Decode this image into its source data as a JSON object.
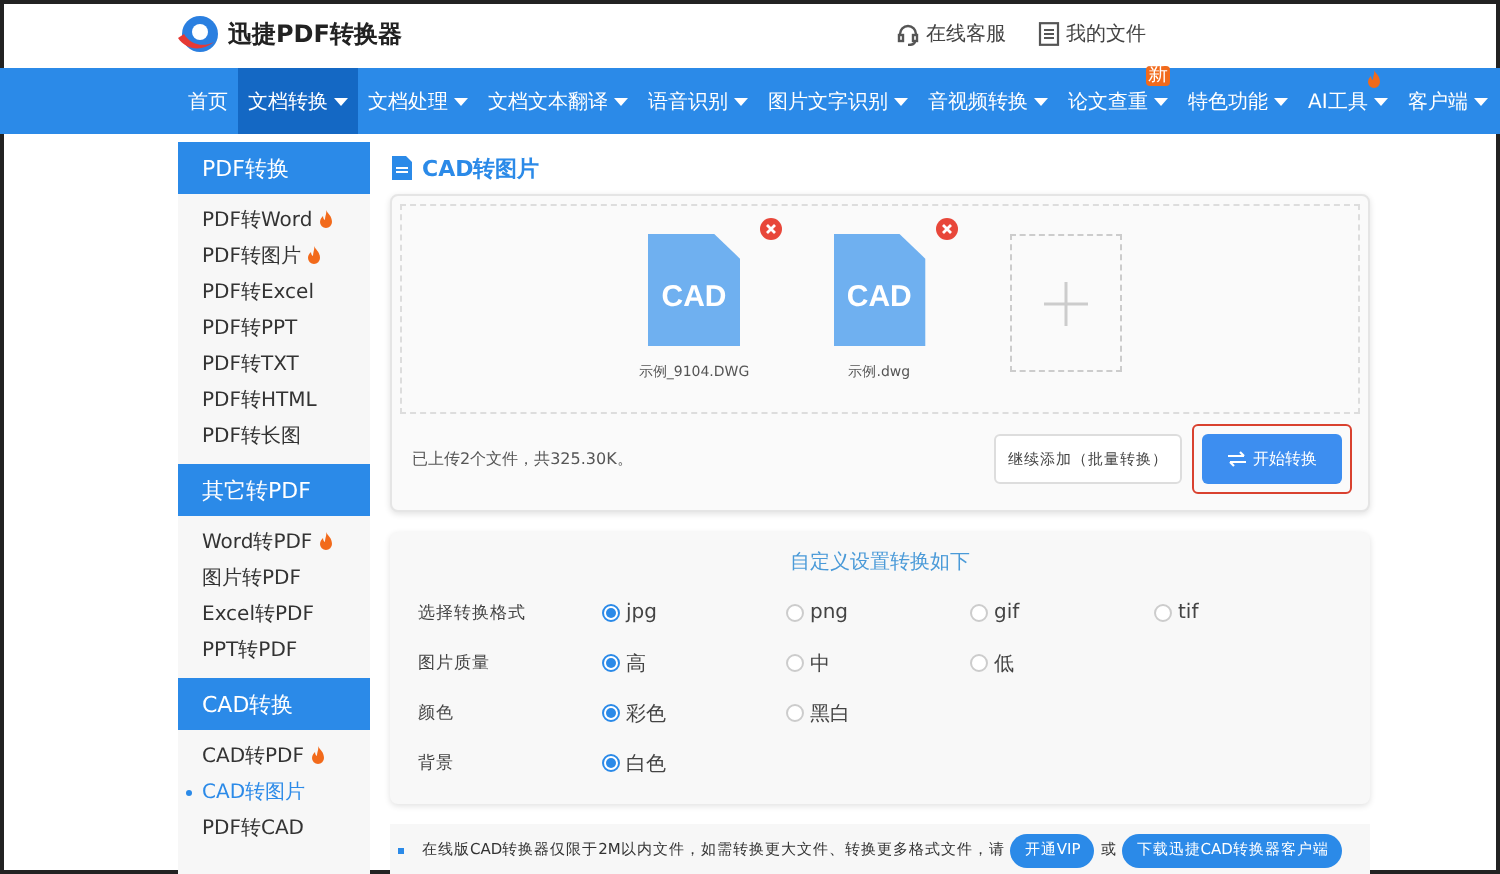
{
  "header": {
    "logo_text": "迅捷PDF转换器",
    "links": [
      {
        "kind": "headset",
        "label": "在线客服"
      },
      {
        "kind": "file",
        "label": "我的文件"
      }
    ]
  },
  "nav": [
    {
      "label": "首页",
      "selected": false,
      "caret": false
    },
    {
      "label": "文档转换",
      "selected": true,
      "caret": true
    },
    {
      "label": "文档处理",
      "selected": false,
      "caret": true
    },
    {
      "label": "文档文本翻译",
      "selected": false,
      "caret": true
    },
    {
      "label": "语音识别",
      "selected": false,
      "caret": true
    },
    {
      "label": "图片文字识别",
      "selected": false,
      "caret": true
    },
    {
      "label": "音视频转换",
      "selected": false,
      "caret": true
    },
    {
      "label": "论文查重",
      "selected": false,
      "caret": true,
      "badge": "新"
    },
    {
      "label": "特色功能",
      "selected": false,
      "caret": true
    },
    {
      "label": "AI工具",
      "selected": false,
      "caret": true,
      "hot": true
    },
    {
      "label": "客户端",
      "selected": false,
      "caret": true
    }
  ],
  "sidebar": {
    "groups": [
      {
        "title": "PDF转换",
        "items": [
          {
            "label": "PDF转Word",
            "hot": true,
            "selected": false
          },
          {
            "label": "PDF转图片",
            "hot": true,
            "selected": false
          },
          {
            "label": "PDF转Excel",
            "hot": false,
            "selected": false
          },
          {
            "label": "PDF转PPT",
            "hot": false,
            "selected": false
          },
          {
            "label": "PDF转TXT",
            "hot": false,
            "selected": false
          },
          {
            "label": "PDF转HTML",
            "hot": false,
            "selected": false
          },
          {
            "label": "PDF转长图",
            "hot": false,
            "selected": false
          }
        ]
      },
      {
        "title": "其它转PDF",
        "items": [
          {
            "label": "Word转PDF",
            "hot": true,
            "selected": false
          },
          {
            "label": "图片转PDF",
            "hot": false,
            "selected": false
          },
          {
            "label": "Excel转PDF",
            "hot": false,
            "selected": false
          },
          {
            "label": "PPT转PDF",
            "hot": false,
            "selected": false
          }
        ]
      },
      {
        "title": "CAD转换",
        "items": [
          {
            "label": "CAD转PDF",
            "hot": true,
            "selected": false
          },
          {
            "label": "CAD转图片",
            "hot": false,
            "selected": true
          },
          {
            "label": "PDF转CAD",
            "hot": false,
            "selected": false
          }
        ]
      }
    ]
  },
  "main": {
    "title": "CAD转图片",
    "files": [
      {
        "icon_label": "CAD",
        "name": "示例_9104.DWG"
      },
      {
        "icon_label": "CAD",
        "name": "示例.dwg"
      }
    ],
    "status": "已上传2个文件，共325.30K。",
    "buttons": [
      {
        "kind": "secondary",
        "label": "继续添加（批量转换）",
        "highlighted": false
      },
      {
        "kind": "primary",
        "label": "开始转换",
        "highlighted": true
      }
    ]
  },
  "settings": {
    "title": "自定义设置转换如下",
    "rows": [
      {
        "label": "选择转换格式",
        "options": [
          {
            "label": "jpg",
            "selected": true
          },
          {
            "label": "png",
            "selected": false
          },
          {
            "label": "gif",
            "selected": false
          },
          {
            "label": "tif",
            "selected": false
          }
        ]
      },
      {
        "label": "图片质量",
        "options": [
          {
            "label": "高",
            "selected": true
          },
          {
            "label": "中",
            "selected": false
          },
          {
            "label": "低",
            "selected": false
          }
        ]
      },
      {
        "label": "颜色",
        "options": [
          {
            "label": "彩色",
            "selected": true
          },
          {
            "label": "黑白",
            "selected": false
          }
        ]
      },
      {
        "label": "背景",
        "options": [
          {
            "label": "白色",
            "selected": true
          }
        ]
      }
    ]
  },
  "notice": {
    "text": "在线版CAD转换器仅限于2M以内文件，如需转换更大文件、转换更多格式文件，请",
    "vip_button": "开通VIP",
    "separator": "或",
    "download_button": "下载迅捷CAD转换器客户端"
  }
}
